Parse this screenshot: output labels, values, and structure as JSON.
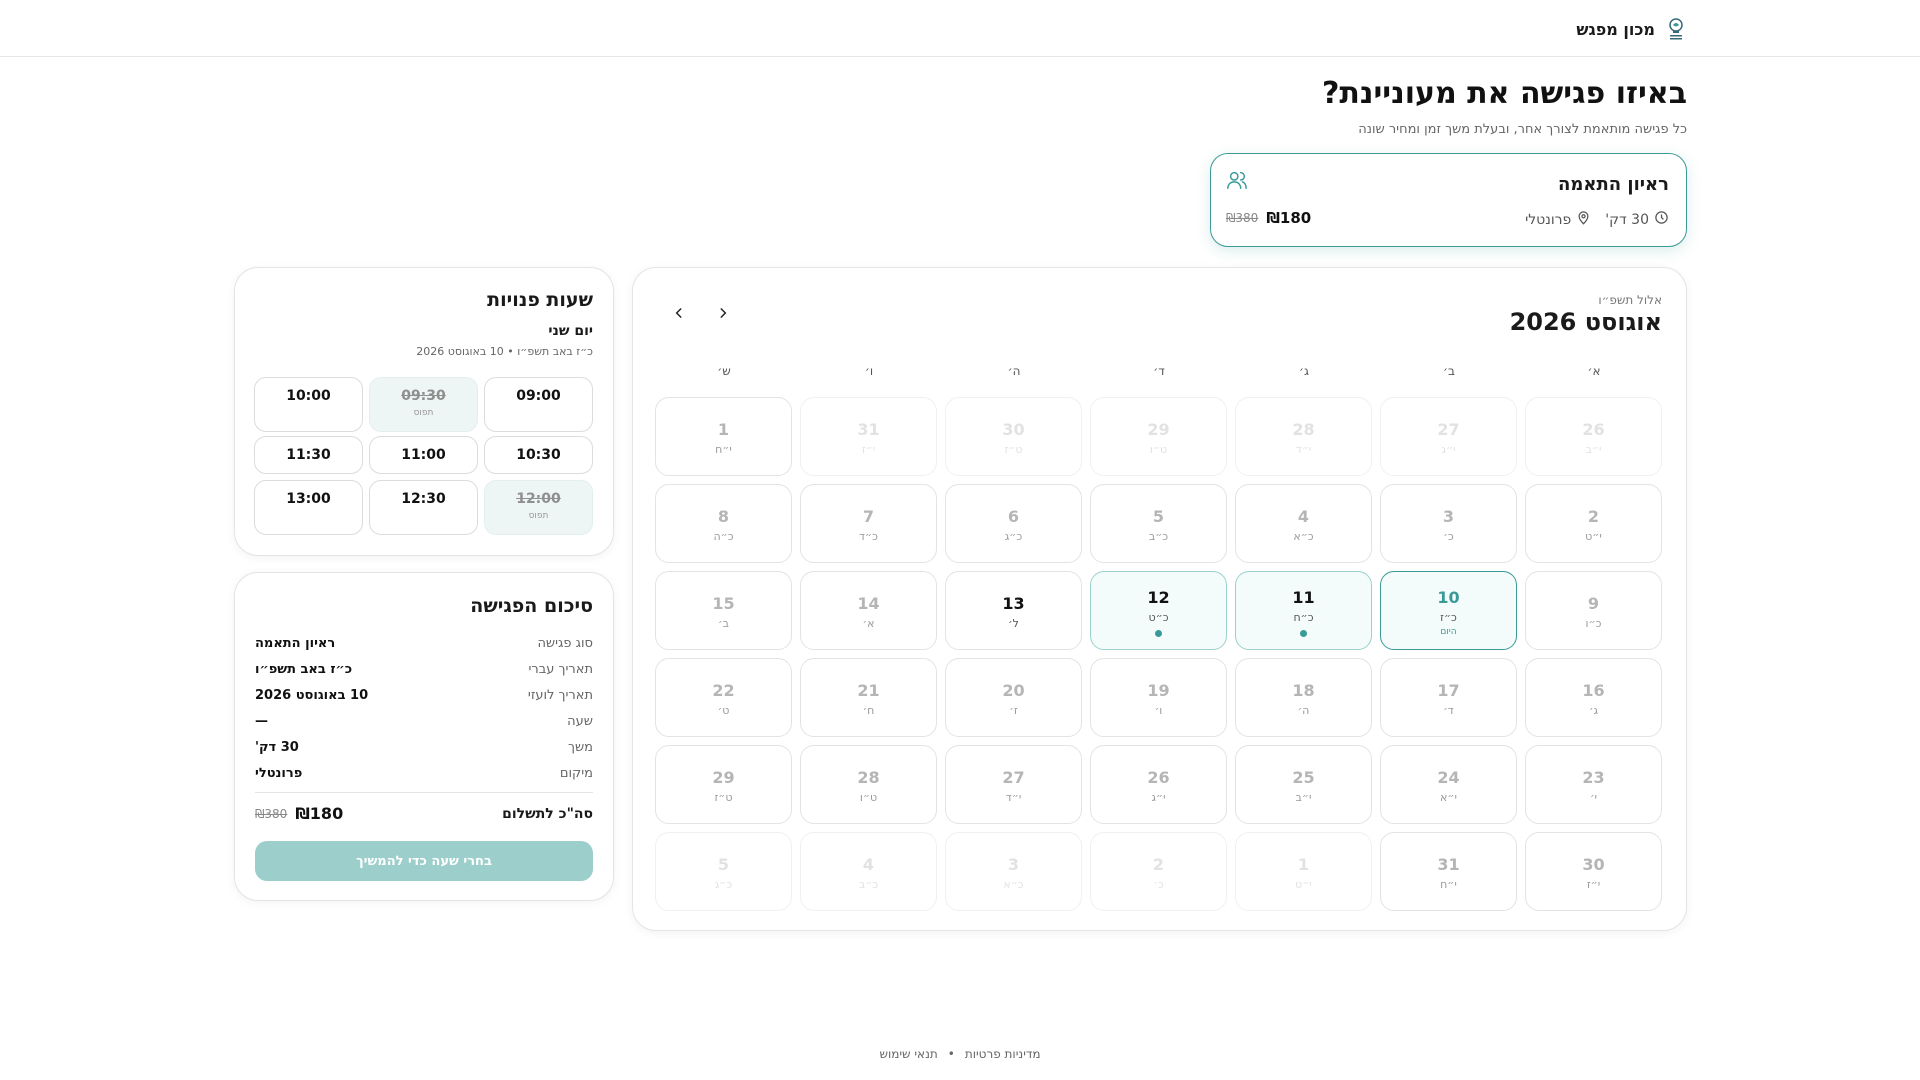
{
  "header": {
    "brand": "מכון מפגש",
    "logo_icon": "brain-lightbulb-icon"
  },
  "page": {
    "title": "באיזו פגישה את מעוניינת?",
    "subtitle": "כל פגישה מותאמת לצורך אחר, ובעלת משך זמן ומחיר שונה"
  },
  "meeting_type": {
    "title": "ראיון התאמה",
    "duration": "30 דק'",
    "location": "פרונטלי",
    "price": "₪180",
    "old_price": "₪380"
  },
  "calendar": {
    "hebrew_month": "אלול תשפ״ו",
    "month": "אוגוסט 2026",
    "weekdays": [
      "א׳",
      "ב׳",
      "ג׳",
      "ד׳",
      "ה׳",
      "ו׳",
      "ש׳"
    ],
    "today_label": "היום",
    "days": [
      {
        "num": "26",
        "heb": "י״ב",
        "state": "muted"
      },
      {
        "num": "27",
        "heb": "י״ג",
        "state": "muted"
      },
      {
        "num": "28",
        "heb": "י״ד",
        "state": "muted"
      },
      {
        "num": "29",
        "heb": "ט״ו",
        "state": "muted"
      },
      {
        "num": "30",
        "heb": "ט״ז",
        "state": "muted"
      },
      {
        "num": "31",
        "heb": "י״ז",
        "state": "muted"
      },
      {
        "num": "1",
        "heb": "י״ח",
        "state": "normal"
      },
      {
        "num": "2",
        "heb": "י״ט",
        "state": "normal"
      },
      {
        "num": "3",
        "heb": "כ׳",
        "state": "normal"
      },
      {
        "num": "4",
        "heb": "כ״א",
        "state": "normal"
      },
      {
        "num": "5",
        "heb": "כ״ב",
        "state": "normal"
      },
      {
        "num": "6",
        "heb": "כ״ג",
        "state": "normal"
      },
      {
        "num": "7",
        "heb": "כ״ד",
        "state": "normal"
      },
      {
        "num": "8",
        "heb": "כ״ה",
        "state": "normal"
      },
      {
        "num": "9",
        "heb": "כ״ו",
        "state": "normal"
      },
      {
        "num": "10",
        "heb": "כ״ז",
        "state": "selected"
      },
      {
        "num": "11",
        "heb": "כ״ח",
        "state": "avail"
      },
      {
        "num": "12",
        "heb": "כ״ט",
        "state": "avail"
      },
      {
        "num": "13",
        "heb": "ל׳",
        "state": "enabled"
      },
      {
        "num": "14",
        "heb": "א׳",
        "state": "normal"
      },
      {
        "num": "15",
        "heb": "ב׳",
        "state": "normal"
      },
      {
        "num": "16",
        "heb": "ג׳",
        "state": "normal"
      },
      {
        "num": "17",
        "heb": "ד׳",
        "state": "normal"
      },
      {
        "num": "18",
        "heb": "ה׳",
        "state": "normal"
      },
      {
        "num": "19",
        "heb": "ו׳",
        "state": "normal"
      },
      {
        "num": "20",
        "heb": "ז׳",
        "state": "normal"
      },
      {
        "num": "21",
        "heb": "ח׳",
        "state": "normal"
      },
      {
        "num": "22",
        "heb": "ט׳",
        "state": "normal"
      },
      {
        "num": "23",
        "heb": "י׳",
        "state": "normal"
      },
      {
        "num": "24",
        "heb": "י״א",
        "state": "normal"
      },
      {
        "num": "25",
        "heb": "י״ב",
        "state": "normal"
      },
      {
        "num": "26",
        "heb": "י״ג",
        "state": "normal"
      },
      {
        "num": "27",
        "heb": "י״ד",
        "state": "normal"
      },
      {
        "num": "28",
        "heb": "ט״ו",
        "state": "normal"
      },
      {
        "num": "29",
        "heb": "ט״ז",
        "state": "normal"
      },
      {
        "num": "30",
        "heb": "י״ז",
        "state": "normal"
      },
      {
        "num": "31",
        "heb": "י״ח",
        "state": "normal"
      },
      {
        "num": "1",
        "heb": "י״ט",
        "state": "muted"
      },
      {
        "num": "2",
        "heb": "כ׳",
        "state": "muted"
      },
      {
        "num": "3",
        "heb": "כ״א",
        "state": "muted"
      },
      {
        "num": "4",
        "heb": "כ״ב",
        "state": "muted"
      },
      {
        "num": "5",
        "heb": "כ״ג",
        "state": "muted"
      }
    ]
  },
  "hours": {
    "title": "שעות פנויות",
    "day": "יום שני",
    "date": "כ״ז באב תשפ״ו • 10 באוגוסט 2026",
    "taken_label": "תפוס",
    "slots": [
      {
        "time": "09:00",
        "taken": false
      },
      {
        "time": "09:30",
        "taken": true
      },
      {
        "time": "10:00",
        "taken": false
      },
      {
        "time": "10:30",
        "taken": false
      },
      {
        "time": "11:00",
        "taken": false
      },
      {
        "time": "11:30",
        "taken": false
      },
      {
        "time": "12:00",
        "taken": true
      },
      {
        "time": "12:30",
        "taken": false
      },
      {
        "time": "13:00",
        "taken": false
      }
    ]
  },
  "summary": {
    "title": "סיכום הפגישה",
    "rows": [
      {
        "label": "סוג פגישה",
        "value": "ראיון התאמה"
      },
      {
        "label": "תאריך עברי",
        "value": "כ״ז באב תשפ״ו"
      },
      {
        "label": "תאריך לועזי",
        "value": "10 באוגוסט 2026"
      },
      {
        "label": "שעה",
        "value": "—"
      },
      {
        "label": "משך",
        "value": "30 דק'"
      },
      {
        "label": "מיקום",
        "value": "פרונטלי"
      }
    ],
    "total_label": "סה\"כ לתשלום",
    "total": "₪180",
    "total_old": "₪380",
    "button": "בחרי שעה כדי להמשיך"
  },
  "footer": {
    "privacy": "מדיניות פרטיות",
    "separator": "•",
    "terms": "תנאי שימוש"
  },
  "colors": {
    "accent": "#3a9a98",
    "button_disabled": "#9ccfcc"
  }
}
